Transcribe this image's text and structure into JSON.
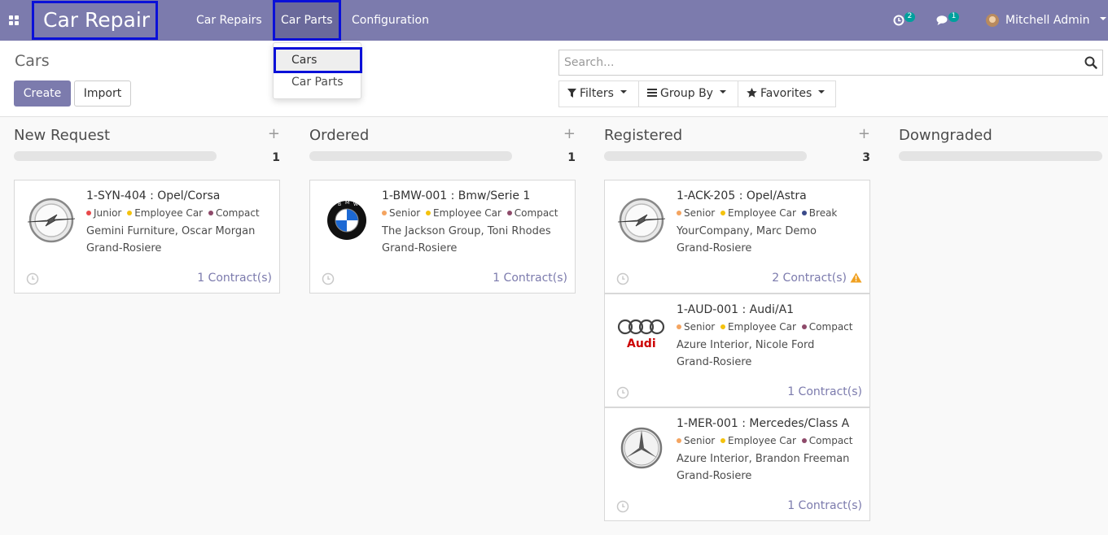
{
  "navbar": {
    "brand": "Car Repair",
    "menu": [
      {
        "label": "Car Repairs"
      },
      {
        "label": "Car Parts"
      },
      {
        "label": "Configuration"
      }
    ],
    "activities_count": "2",
    "messages_count": "1",
    "user_name": "Mitchell Admin",
    "color": "#7c7bad"
  },
  "dropdown": {
    "items": [
      {
        "label": "Cars"
      },
      {
        "label": "Car Parts"
      }
    ]
  },
  "control": {
    "title": "Cars",
    "create_label": "Create",
    "import_label": "Import",
    "search_placeholder": "Search...",
    "filters_label": "Filters",
    "groupby_label": "Group By",
    "favorites_label": "Favorites"
  },
  "columns": [
    {
      "title": "New Request",
      "count": "1",
      "cards": [
        {
          "title": "1-SYN-404 : Opel/Corsa",
          "logo": "opel-logo",
          "tags": [
            {
              "label": "Junior",
              "color": "#e8484a"
            },
            {
              "label": "Employee Car",
              "color": "#f4c20d"
            },
            {
              "label": "Compact",
              "color": "#8e4a6a"
            }
          ],
          "line2": "Gemini Furniture, Oscar Morgan",
          "line3": "Grand-Rosiere",
          "contracts": "1 Contract(s)",
          "warning": false
        }
      ]
    },
    {
      "title": "Ordered",
      "count": "1",
      "cards": [
        {
          "title": "1-BMW-001 : Bmw/Serie 1",
          "logo": "bmw-logo",
          "tags": [
            {
              "label": "Senior",
              "color": "#f4a460"
            },
            {
              "label": "Employee Car",
              "color": "#f4c20d"
            },
            {
              "label": "Compact",
              "color": "#8e4a6a"
            }
          ],
          "line2": "The Jackson Group, Toni Rhodes",
          "line3": "Grand-Rosiere",
          "contracts": "1 Contract(s)",
          "warning": false
        }
      ]
    },
    {
      "title": "Registered",
      "count": "3",
      "cards": [
        {
          "title": "1-ACK-205 : Opel/Astra",
          "logo": "opel-logo",
          "tags": [
            {
              "label": "Senior",
              "color": "#f4a460"
            },
            {
              "label": "Employee Car",
              "color": "#f4c20d"
            },
            {
              "label": "Break",
              "color": "#3a4a8a"
            }
          ],
          "line2": "YourCompany, Marc Demo",
          "line3": "Grand-Rosiere",
          "contracts": "2 Contract(s)",
          "warning": true
        },
        {
          "title": "1-AUD-001 : Audi/A1",
          "logo": "audi-logo",
          "tags": [
            {
              "label": "Senior",
              "color": "#f4a460"
            },
            {
              "label": "Employee Car",
              "color": "#f4c20d"
            },
            {
              "label": "Compact",
              "color": "#8e4a6a"
            }
          ],
          "line2": "Azure Interior, Nicole Ford",
          "line3": "Grand-Rosiere",
          "contracts": "1 Contract(s)",
          "warning": false
        },
        {
          "title": "1-MER-001 : Mercedes/Class A",
          "logo": "mercedes-logo",
          "tags": [
            {
              "label": "Senior",
              "color": "#f4a460"
            },
            {
              "label": "Employee Car",
              "color": "#f4c20d"
            },
            {
              "label": "Compact",
              "color": "#8e4a6a"
            }
          ],
          "line2": "Azure Interior, Brandon Freeman",
          "line3": "Grand-Rosiere",
          "contracts": "1 Contract(s)",
          "warning": false
        }
      ]
    },
    {
      "title": "Downgraded",
      "count": "",
      "cards": []
    }
  ]
}
